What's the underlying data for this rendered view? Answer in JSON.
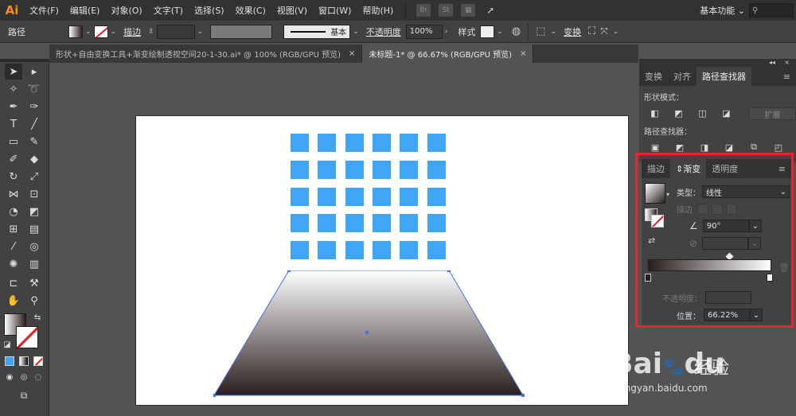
{
  "app": {
    "logo": "Ai"
  },
  "menu": [
    "文件(F)",
    "编辑(E)",
    "对象(O)",
    "文字(T)",
    "选择(S)",
    "效果(C)",
    "视图(V)",
    "窗口(W)",
    "帮助(H)"
  ],
  "menubar_icons": {
    "br": "Br",
    "st": "St"
  },
  "workspace": {
    "label": "基本功能",
    "search_icon": "search-icon"
  },
  "control_bar": {
    "object_label": "路径",
    "stroke_label": "描边",
    "stroke_profile": "基本",
    "opacity_label": "不透明度",
    "opacity_value": "100%",
    "style_label": "样式",
    "transform_label": "变换"
  },
  "document_tabs": [
    {
      "title": "形状+自由变换工具+渐变绘制透视空间20-1-30.ai* @ 100% (RGB/GPU 预览)",
      "close": "×"
    },
    {
      "title": "未标题-1* @ 66.67% (RGB/GPU 预览)",
      "close": "×"
    }
  ],
  "panels": {
    "top_tabs": [
      "变换",
      "对齐",
      "路径查找器"
    ],
    "shape_modes_label": "形状模式：",
    "expand_button": "扩展",
    "pathfinders_label": "路径查找器："
  },
  "gradient_panel": {
    "tabs": [
      "描边",
      "渐变",
      "透明度"
    ],
    "type_label": "类型：",
    "type_value": "线性",
    "stroke_label": "描边",
    "angle_value": "90°",
    "opacity_label": "不透明度：",
    "location_label": "位置：",
    "location_value": "66.22%",
    "gradient_start_color": "#2a1e1e",
    "gradient_end_color": "#ffffff",
    "midpoint_percent": 66.22
  },
  "canvas": {
    "square_color": "#3fa5f5",
    "grid_rows": 5,
    "grid_cols": 6,
    "trapezoid_top_color": "#ffffff",
    "trapezoid_bottom_color": "#2a1e1e"
  },
  "watermark": {
    "logo": "Bai",
    "logo_suffix": "du",
    "text": "经验",
    "url": "jingyan.baidu.com"
  }
}
